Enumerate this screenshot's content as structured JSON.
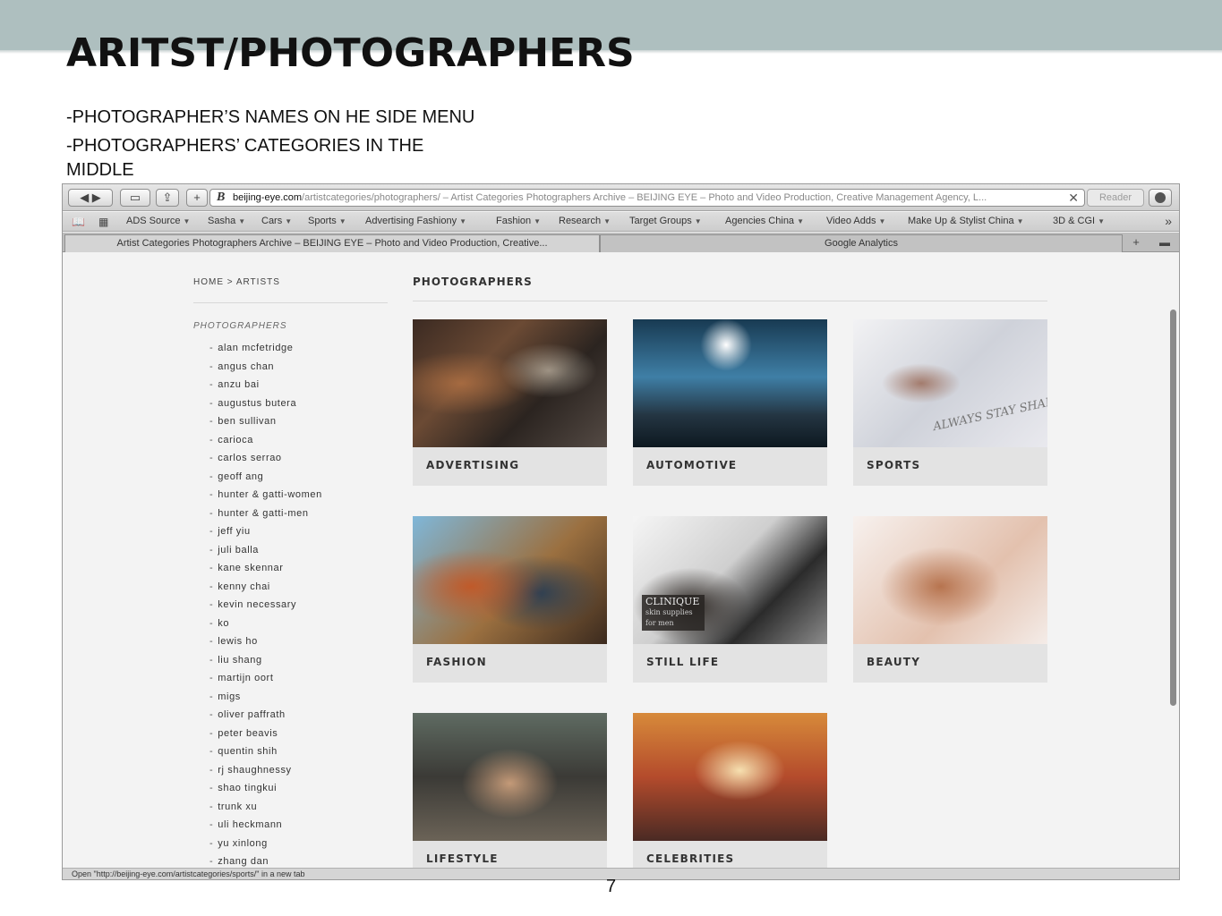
{
  "slide": {
    "title": "ARITST/PHOTOGRAPHERS",
    "bullets": [
      "-PHOTOGRAPHER’S NAMES ON HE SIDE MENU",
      "-PHOTOGRAPHERS’ CATEGORIES IN THE MIDDLE"
    ],
    "page_number": "7"
  },
  "browser": {
    "url_host": "beijing-eye.com",
    "url_path": "/artistcategories/photographers/ – Artist Categories Photographers Archive – BEIJING EYE – Photo and Video Production, Creative Management Agency, L...",
    "reader_label": "Reader",
    "bookmarks": [
      "ADS Source",
      "Sasha",
      "Cars",
      "Sports",
      "Advertising Fashiony",
      "Fashion",
      "Research",
      "Target Groups",
      "Agencies China",
      "Video Adds",
      "Make Up & Stylist China",
      "3D & CGI"
    ],
    "tabs": [
      "Artist Categories Photographers Archive – BEIJING EYE – Photo and Video Production, Creative...",
      "Google Analytics"
    ],
    "status_text": "Open \"http://beijing-eye.com/artistcategories/sports/\" in a new tab"
  },
  "site": {
    "breadcrumb": "HOME > ARTISTS",
    "sidebar_heading": "PHOTOGRAPHERS",
    "photographers": [
      "alan mcfetridge",
      "angus chan",
      "anzu bai",
      "augustus butera",
      "ben sullivan",
      "carioca",
      "carlos serrao",
      "geoff ang",
      "hunter & gatti-women",
      "hunter & gatti-men",
      "jeff yiu",
      "juli balla",
      "kane skennar",
      "kenny chai",
      "kevin necessary",
      "ko",
      "lewis ho",
      "liu shang",
      "martijn oort",
      "migs",
      "oliver paffrath",
      "peter beavis",
      "quentin shih",
      "rj shaughnessy",
      "shao tingkui",
      "trunk xu",
      "uli heckmann",
      "yu xinlong",
      "zhang dan"
    ],
    "main_heading": "PHOTOGRAPHERS",
    "categories": [
      "ADVERTISING",
      "AUTOMOTIVE",
      "SPORTS",
      "FASHION",
      "STILL LIFE",
      "BEAUTY",
      "LIFESTYLE",
      "CELEBRITIES"
    ],
    "sports_image_text": "ALWAYS STAY SHARP",
    "still_life_image_text": "CLINIQUE",
    "still_life_image_subtext": "skin supplies for men"
  }
}
